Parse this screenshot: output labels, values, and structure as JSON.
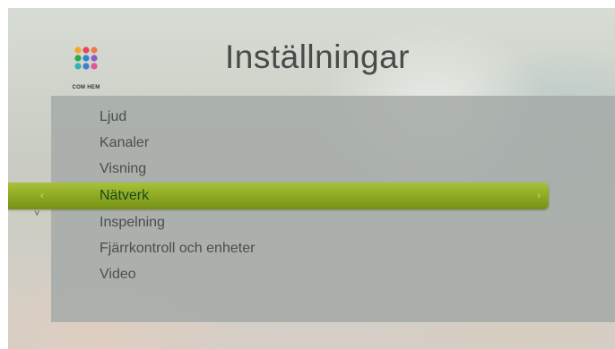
{
  "header": {
    "title": "Inställningar",
    "logo_text": "COM HEM"
  },
  "menu": {
    "items": [
      {
        "label": "Ljud",
        "selected": false
      },
      {
        "label": "Kanaler",
        "selected": false
      },
      {
        "label": "Visning",
        "selected": false
      },
      {
        "label": "Nätverk",
        "selected": true
      },
      {
        "label": "Inspelning",
        "selected": false
      },
      {
        "label": "Fjärrkontroll och enheter",
        "selected": false
      },
      {
        "label": "Video",
        "selected": false
      }
    ],
    "left_arrow": "‹",
    "right_arrow": "›",
    "down_chevron": "˅"
  },
  "colors": {
    "highlight": "#8eaa22",
    "panel": "#a6aca8",
    "title_text": "#4a4a4a",
    "logo_dots": [
      "#f5a623",
      "#e8445a",
      "#f27a4a",
      "#2ca84a",
      "#2f86c9",
      "#8e5bc2",
      "#2fb6a8",
      "#3f7fd0",
      "#e0559b"
    ]
  },
  "icons": {
    "logo": "com-hem-dot-grid-logo",
    "left": "chevron-left-icon",
    "right": "chevron-right-icon",
    "down": "chevron-down-icon"
  }
}
